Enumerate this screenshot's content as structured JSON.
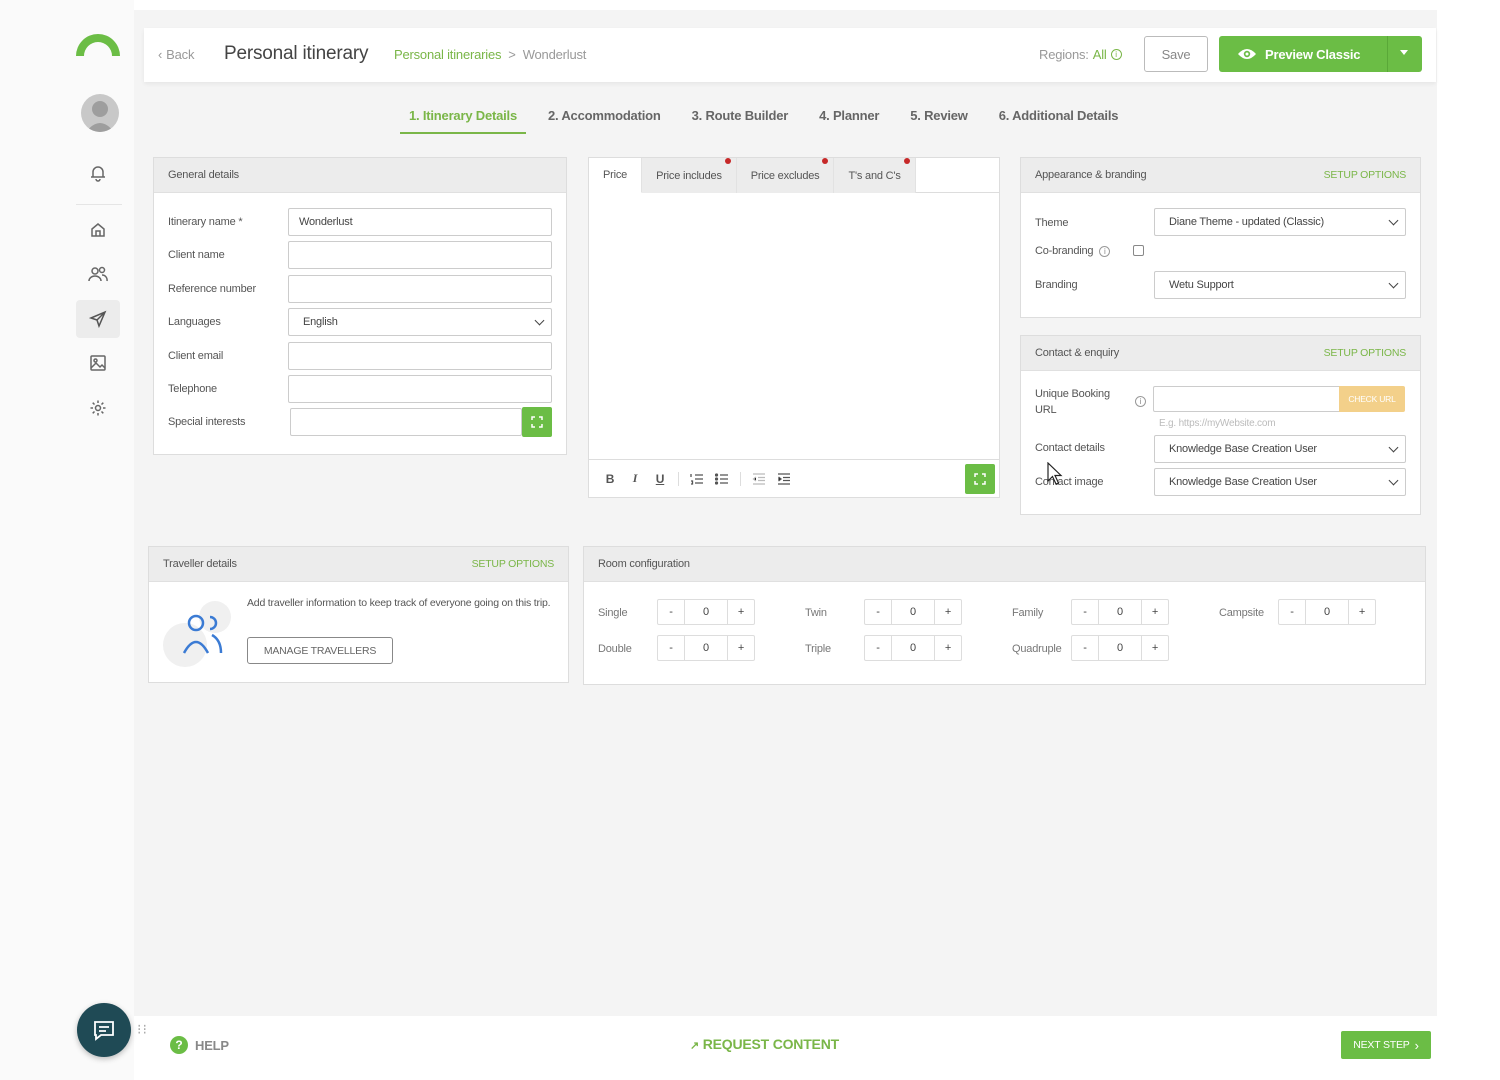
{
  "header": {
    "back_label": "Back",
    "title": "Personal itinerary",
    "breadcrumb": {
      "parent": "Personal itineraries",
      "separator": ">",
      "current": "Wonderlust"
    },
    "regions_label": "Regions:",
    "regions_value": "All",
    "save_label": "Save",
    "preview_label": "Preview Classic"
  },
  "steps": [
    {
      "label": "1. Itinerary Details",
      "active": true
    },
    {
      "label": "2. Accommodation"
    },
    {
      "label": "3. Route Builder"
    },
    {
      "label": "4. Planner"
    },
    {
      "label": "5. Review"
    },
    {
      "label": "6. Additional Details"
    }
  ],
  "general": {
    "title": "General details",
    "fields": [
      {
        "label": "Itinerary name *",
        "value": "Wonderlust"
      },
      {
        "label": "Client name",
        "value": ""
      },
      {
        "label": "Reference number",
        "value": ""
      },
      {
        "label": "Languages",
        "value": "English"
      },
      {
        "label": "Client email",
        "value": ""
      },
      {
        "label": "Telephone",
        "value": ""
      },
      {
        "label": "Special interests",
        "value": ""
      }
    ]
  },
  "editor": {
    "tabs": [
      "Price",
      "Price includes",
      "Price excludes",
      "T's and C's"
    ],
    "toolbar": {
      "bold": "B",
      "italic": "I",
      "underline": "U"
    }
  },
  "appearance": {
    "title": "Appearance & branding",
    "setup": "SETUP OPTIONS",
    "theme_label": "Theme",
    "theme_value": "Diane Theme - updated (Classic)",
    "cobranding_label": "Co-branding",
    "branding_label": "Branding",
    "branding_value": "Wetu Support"
  },
  "contact": {
    "title": "Contact & enquiry",
    "setup": "SETUP OPTIONS",
    "url_label_1": "Unique Booking",
    "url_label_2": "URL",
    "check_label": "CHECK URL",
    "url_hint": "E.g. https://myWebsite.com",
    "details_label": "Contact details",
    "details_value": "Knowledge Base Creation User",
    "image_label": "Contact image",
    "image_value": "Knowledge Base Creation User"
  },
  "traveller": {
    "title": "Traveller details",
    "setup": "SETUP OPTIONS",
    "text": "Add traveller information to keep track of everyone going on this trip.",
    "button": "MANAGE TRAVELLERS"
  },
  "room": {
    "title": "Room configuration",
    "minus": "-",
    "plus": "+",
    "items": [
      {
        "label": "Single",
        "value": "0"
      },
      {
        "label": "Twin",
        "value": "0"
      },
      {
        "label": "Family",
        "value": "0"
      },
      {
        "label": "Campsite",
        "value": "0"
      },
      {
        "label": "Double",
        "value": "0"
      },
      {
        "label": "Triple",
        "value": "0"
      },
      {
        "label": "Quadruple",
        "value": "0"
      }
    ]
  },
  "footer": {
    "help": "HELP",
    "help_glyph": "?",
    "request": "REQUEST CONTENT",
    "next": "NEXT STEP"
  },
  "colors": {
    "accent": "#6bbd45",
    "accent_text": "#7ab648",
    "chat": "#1f4a55"
  }
}
